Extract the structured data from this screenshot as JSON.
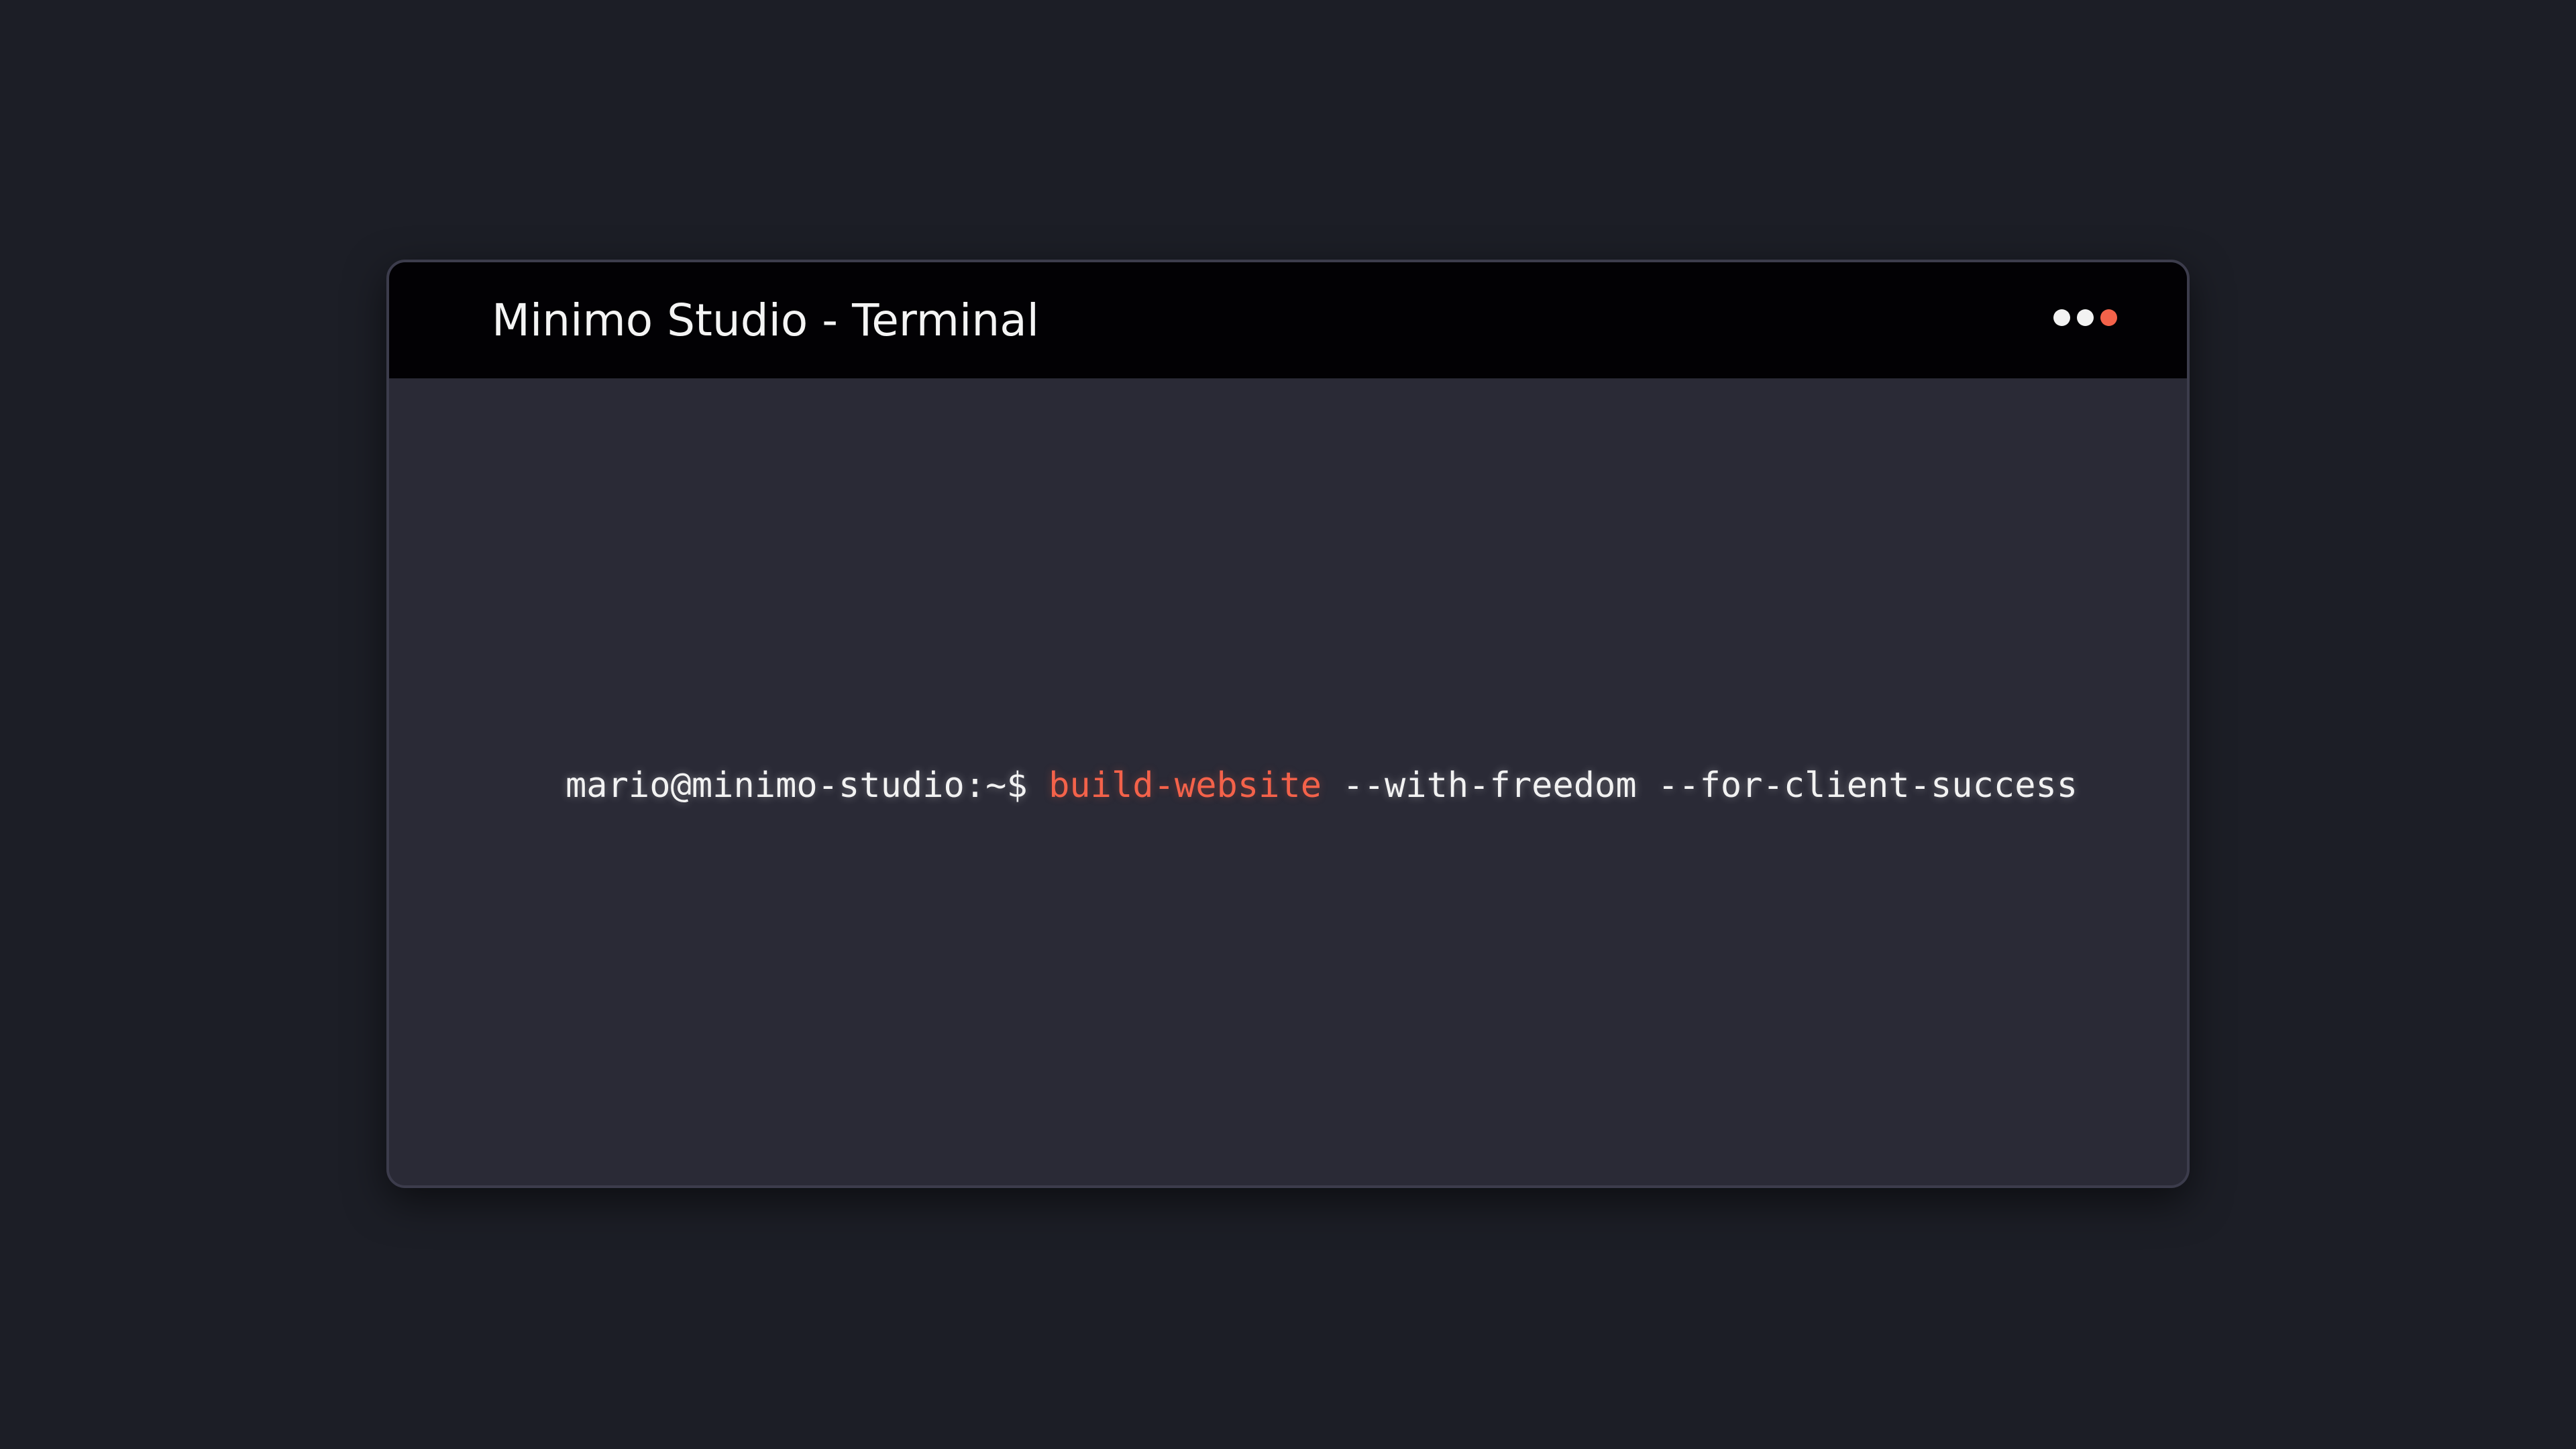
{
  "window": {
    "title": "Minimo Studio - Terminal",
    "controls": [
      {
        "name": "control-dot-1",
        "color": "#f2f2f2"
      },
      {
        "name": "control-dot-2",
        "color": "#f2f2f2"
      },
      {
        "name": "control-dot-3",
        "color": "#f4624a"
      }
    ]
  },
  "terminal": {
    "prompt": "mario@minimo-studio:~$",
    "command": "build-website",
    "args": "--with-freedom --for-client-success"
  },
  "colors": {
    "background": "#1c1e26",
    "titlebar": "#020104",
    "terminal_body": "#2a2a36",
    "accent": "#f4624a",
    "text": "#f2f2f2"
  }
}
